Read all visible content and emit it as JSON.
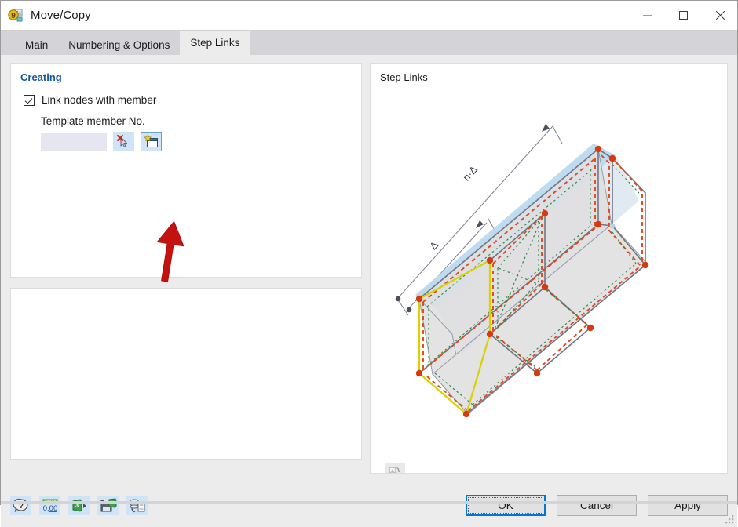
{
  "window": {
    "title": "Move/Copy",
    "app_icon": "move-copy-app-icon",
    "controls": {
      "minimize": "minimize-icon",
      "maximize": "maximize-icon",
      "close": "close-icon"
    }
  },
  "tabs": [
    {
      "label": "Main",
      "active": false
    },
    {
      "label": "Numbering & Options",
      "active": false
    },
    {
      "label": "Step Links",
      "active": true
    }
  ],
  "creating": {
    "group_title": "Creating",
    "checkbox": {
      "label": "Link nodes with member",
      "checked": true
    },
    "template_label": "Template member No.",
    "template_input": {
      "value": "",
      "placeholder": ""
    },
    "buttons": [
      {
        "name": "pick-member-icon",
        "tooltip": "Select member graphically"
      },
      {
        "name": "new-member-icon",
        "tooltip": "New member"
      }
    ]
  },
  "annotation": {
    "arrow": "red-arrow-pointing-up",
    "color": "#cc1111"
  },
  "step_links": {
    "group_title": "Step Links",
    "view_icon": "rotate-view-icon",
    "diagram": {
      "dimension_labels": [
        "n·Δ",
        "Δ"
      ],
      "colors": {
        "member": "#e04a20",
        "link": "#2e8b3f",
        "highlight": "#d8d000",
        "node": "#d83a10",
        "slab": "#b8d4ea"
      }
    }
  },
  "footer": {
    "tools": [
      {
        "name": "help-icon",
        "label": "Help"
      },
      {
        "name": "units-icon",
        "label": "0,00"
      },
      {
        "name": "settings-icon",
        "label": "Settings"
      },
      {
        "name": "save-settings-icon",
        "label": "Save settings"
      },
      {
        "name": "database-icon",
        "label": "Database"
      }
    ],
    "buttons": {
      "ok": "OK",
      "cancel": "Cancel",
      "apply": "Apply"
    }
  }
}
